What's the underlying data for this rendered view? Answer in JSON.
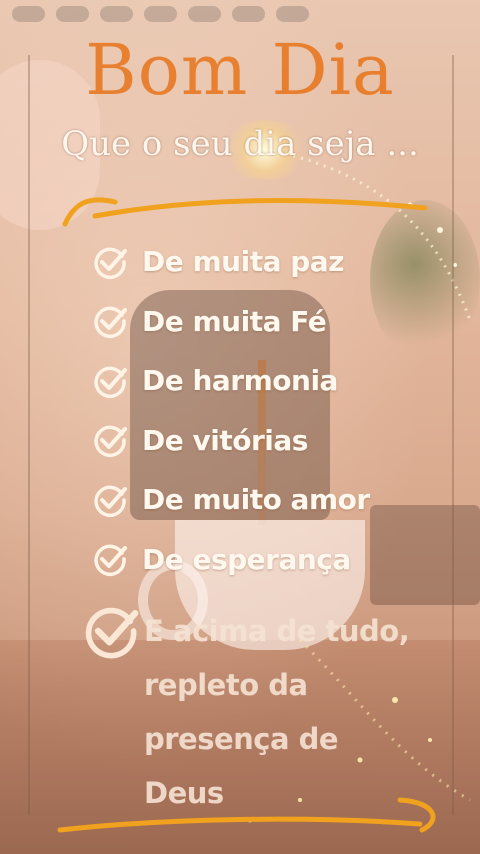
{
  "header": {
    "title": "Bom Dia",
    "subtitle": "Que o seu dia seja ..."
  },
  "list": {
    "items": [
      {
        "label": "De muita paz",
        "icon": "check-circle-icon"
      },
      {
        "label": "De muita Fé",
        "icon": "check-circle-icon"
      },
      {
        "label": "De harmonia",
        "icon": "check-circle-icon"
      },
      {
        "label": "De vitórias",
        "icon": "check-circle-icon"
      },
      {
        "label": "De muito amor",
        "icon": "check-circle-icon"
      },
      {
        "label": "De esperança",
        "icon": "check-circle-icon"
      }
    ],
    "final": {
      "label": "E acima de tudo,\nrepleto da\npresença  de\nDeus",
      "icon": "check-circle-icon"
    }
  },
  "colors": {
    "title": "#e77a25",
    "accent_brush": "#f0a21e",
    "text": "#fff8ee",
    "background": "#e3b79d"
  }
}
